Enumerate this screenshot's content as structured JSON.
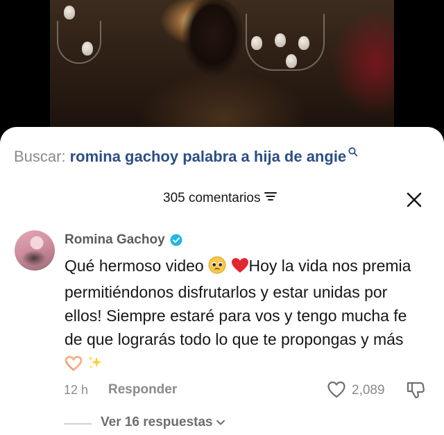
{
  "search": {
    "prefix": "Buscar:",
    "query": "romina gachoy palabra a hija de angie",
    "icon": "search-icon"
  },
  "header": {
    "comment_count": "305 comentarios",
    "sort_icon": "sort-icon",
    "close_icon": "close-icon"
  },
  "comment": {
    "author": "Romina Gachoy",
    "verified": true,
    "text_part1": "Qué hermoso video ",
    "text_part2": "Hoy la vida nos premia permitiéndonos disfrutarlos y estar unidas por ellos! Siempre estaré para vos y tengo mucha fe de que lograrás todo lo que te propongas y más ",
    "time_ago": "12 h",
    "reply_label": "Responder",
    "like_count": "2,089",
    "view_replies": "Ver 16 respuestas"
  },
  "colors": {
    "search_query": "#2c4e86",
    "muted_text": "#8a8a8a",
    "verified_badge": "#20b6e8",
    "heart_emoji": "#e2262f"
  }
}
